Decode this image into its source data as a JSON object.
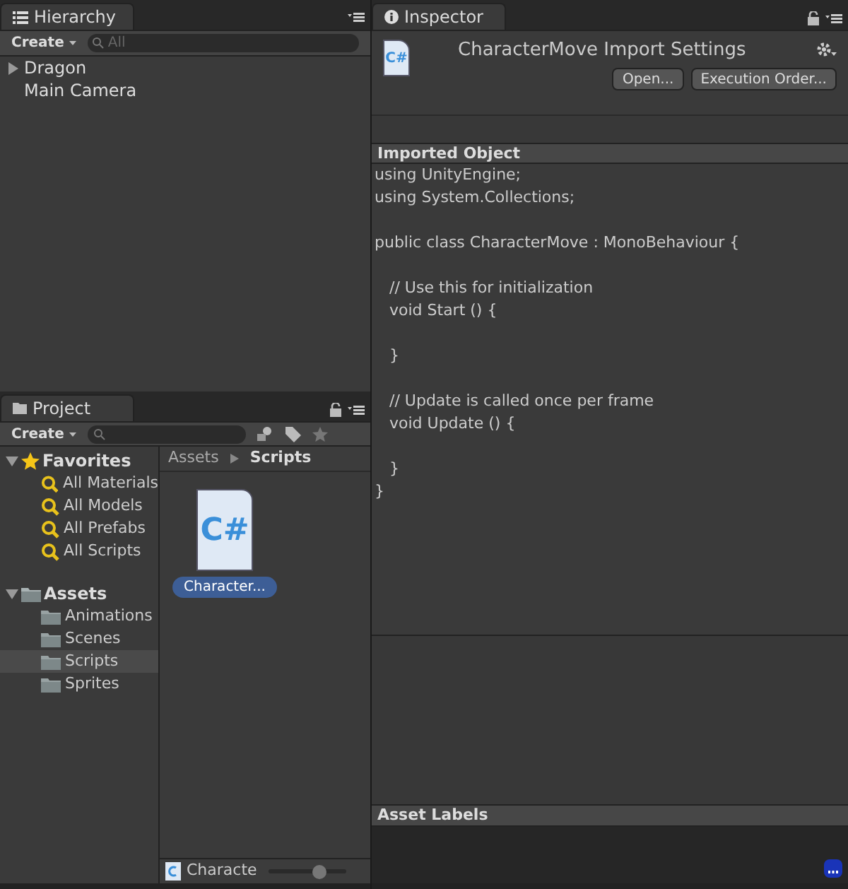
{
  "hierarchy": {
    "tab": "Hierarchy",
    "create": "Create",
    "search": {
      "placeholder": "All"
    },
    "items": [
      {
        "label": "Dragon",
        "kind": "group",
        "expanded": false
      },
      {
        "label": "Main Camera",
        "kind": "object"
      }
    ]
  },
  "project": {
    "tab": "Project",
    "create": "Create",
    "tree": [
      {
        "label": "Favorites",
        "kind": "favorites",
        "expanded": true,
        "selected": false,
        "children": [
          {
            "label": "All Materials",
            "kind": "search",
            "selected": false
          },
          {
            "label": "All Models",
            "kind": "search",
            "selected": false
          },
          {
            "label": "All Prefabs",
            "kind": "search",
            "selected": false
          },
          {
            "label": "All Scripts",
            "kind": "search",
            "selected": false
          }
        ]
      },
      {
        "label": "Assets",
        "kind": "folder",
        "expanded": true,
        "selected": false,
        "children": [
          {
            "label": "Animations",
            "kind": "folder",
            "selected": false
          },
          {
            "label": "Scenes",
            "kind": "folder",
            "selected": false
          },
          {
            "label": "Scripts",
            "kind": "folder",
            "selected": true
          },
          {
            "label": "Sprites",
            "kind": "folder",
            "selected": false
          }
        ]
      }
    ],
    "breadcrumb": [
      "Assets",
      "Scripts"
    ],
    "files": [
      {
        "label": "Character...",
        "icon_text": "C#",
        "selected": true
      }
    ],
    "status": {
      "label": "Characte",
      "level": 0.65
    }
  },
  "inspector": {
    "tab": "Inspector",
    "title": "CharacterMove Import Settings",
    "icon_text": "C#",
    "buttons": [
      "Open...",
      "Execution Order..."
    ],
    "section": "Imported Object",
    "code": "using UnityEngine;\nusing System.Collections;\n\npublic class CharacterMove : MonoBehaviour {\n\n\t// Use this for initialization\n\tvoid Start () {\n\t\n\t}\n\t\n\t// Update is called once per frame\n\tvoid Update () {\n\t\n\t}\n}",
    "labels_header": "Asset Labels"
  }
}
